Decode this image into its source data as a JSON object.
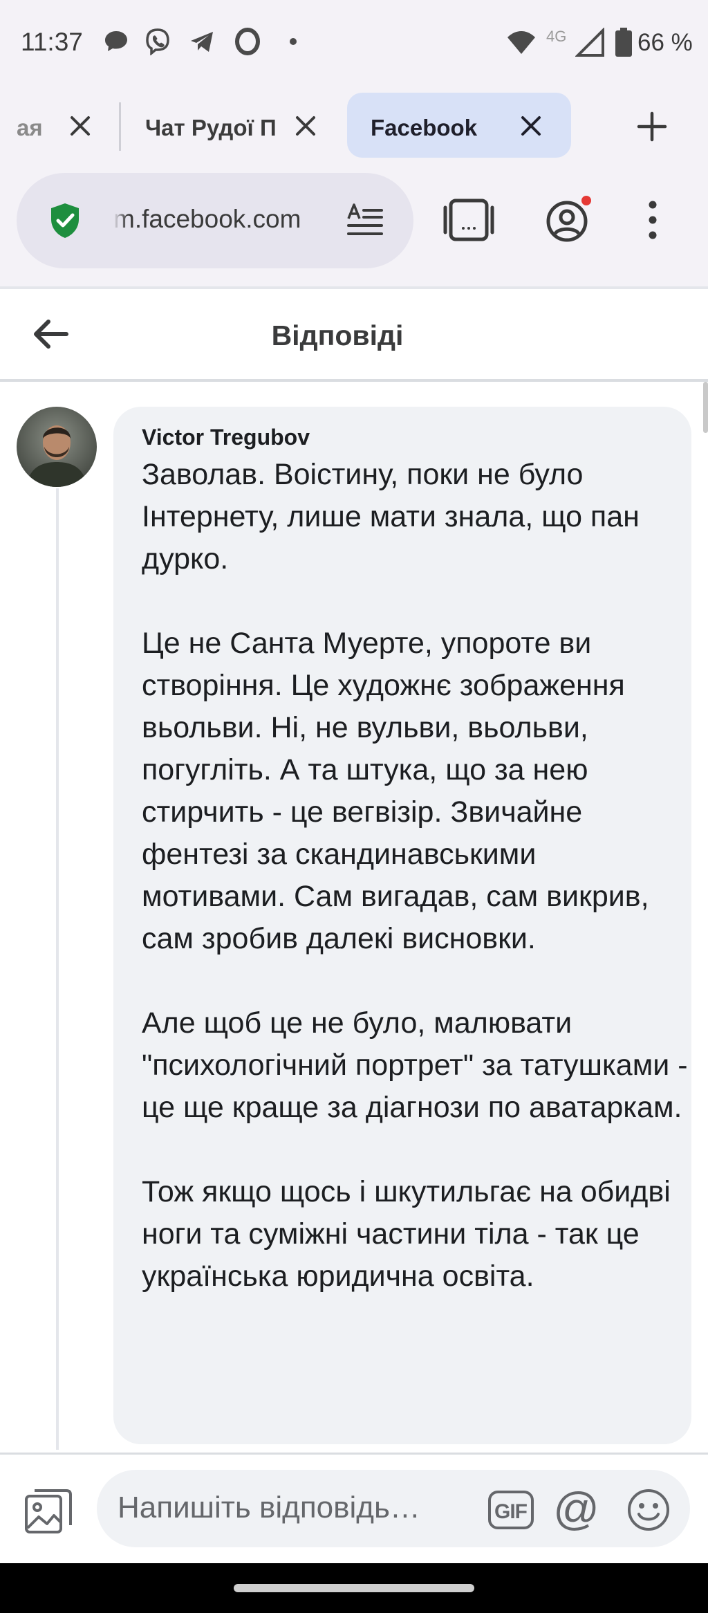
{
  "status_bar": {
    "time": "11:37",
    "network": "4G",
    "battery": "66 %",
    "icons": [
      "chat-bubble-icon",
      "viber-icon",
      "telegram-icon",
      "opera-icon",
      "dot-icon",
      "wifi-icon",
      "signal-icon",
      "battery-icon"
    ]
  },
  "tabs": {
    "items": [
      {
        "label": "ая",
        "active": false
      },
      {
        "label": "Чат Рудої Па",
        "active": false
      },
      {
        "label": "Facebook",
        "active": true
      }
    ],
    "new_tab_icon": "plus-icon",
    "close_icon": "close-icon"
  },
  "address_bar": {
    "url": "m.facebook.com",
    "security_icon": "shield-check-icon",
    "reader_icon": "reader-mode-icon",
    "tab_switcher_icon": "tab-switcher-icon",
    "account_icon": "account-icon",
    "menu_icon": "more-vert-icon",
    "colors": {
      "shield": "#1e8e3e",
      "notification_dot": "#e53935"
    }
  },
  "header": {
    "title": "Відповіді",
    "back_icon": "arrow-left-icon"
  },
  "comment": {
    "author": "Victor Tregubov",
    "text": "Заволав. Воістину, поки не було Інтернету, лише мати знала, що пан дурко.\n\nЦе не Санта Муерте, упороте ви створіння. Це художнє зображення вьольви. Ні, не вульви, вьольви, погугліть. А та штука, що за нею стирчить - це вегвізір. Звичайне фентезі за скандинавськими мотивами. Сам вигадав, сам викрив, сам зробив далекі висновки.\n\nАле щоб це не було, малювати \"психологічний портрет\" за татушками - це ще краще за діагнози по аватаркам.\n\nТож якщо щось і шкутильгає на обидві ноги та суміжні частини тіла - так це українська юридична освіта."
  },
  "composer": {
    "placeholder": "Напишіть відповідь…",
    "photo_icon": "photo-icon",
    "gif_label": "GIF",
    "mention_label": "@",
    "emoji_icon": "emoji-icon"
  }
}
